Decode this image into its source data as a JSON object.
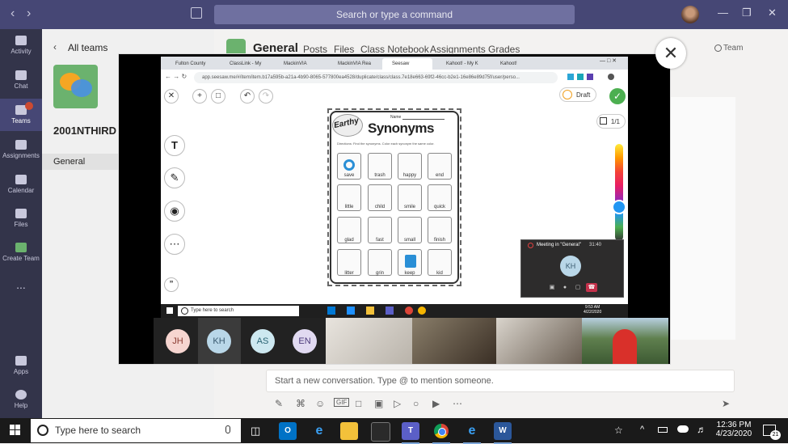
{
  "teams": {
    "search_placeholder": "Search or type a command",
    "rail": [
      {
        "label": "Activity"
      },
      {
        "label": "Chat"
      },
      {
        "label": "Teams"
      },
      {
        "label": "Assignments"
      },
      {
        "label": "Calendar"
      },
      {
        "label": "Files"
      },
      {
        "label": "Create Team"
      },
      {
        "label": "Apps"
      },
      {
        "label": "Help"
      }
    ],
    "teams_badge": "",
    "more_label": "...",
    "all_teams": "All teams",
    "team_name": "2001NTHIRD",
    "channel": "General",
    "header": {
      "title": "General",
      "tabs": [
        "Posts",
        "Files",
        "Class Notebook",
        "Assignments",
        "Grades"
      ],
      "team_button": "Team"
    },
    "compose_placeholder": "Start a new conversation. Type @ to mention someone."
  },
  "shared_screen": {
    "browser_tabs": [
      "Fulton County",
      "ClassLink - My",
      "MackinVIA",
      "MackinVIA Rea",
      "Seesaw",
      "Kahoot! - My K",
      "Kahoot!"
    ],
    "url": "app.seesaw.me/#/item/item.b17a595b-a21a-4b90-8065-577800ea4528/duplicate/class/class.7e18e663-69f2-46cc-b2e1-16e86e89d75f/user/perso...",
    "draft_label": "Draft",
    "page_count": "1/1",
    "worksheet": {
      "earthy": "Earthy",
      "title": "Synonyms",
      "name_label": "Name",
      "directions": "Directions: Find the synonyms. Color each synonym the same color.",
      "words": [
        [
          "save",
          "trash",
          "happy",
          "end"
        ],
        [
          "little",
          "child",
          "smile",
          "quick"
        ],
        [
          "glad",
          "fast",
          "small",
          "finish"
        ],
        [
          "litter",
          "grin",
          "keep",
          "kid"
        ]
      ]
    },
    "inner_search": "Type here to search",
    "inner_time": "9:53 AM",
    "inner_date": "4/22/2020",
    "mini_meeting": {
      "title": "Meeting in \"General\"",
      "time": "31:40",
      "avatar": "KH"
    }
  },
  "participants": [
    "JH",
    "KH",
    "AS",
    "EN"
  ],
  "taskbar": {
    "search": "Type here to search",
    "time": "12:36 PM",
    "date": "4/23/2020",
    "notifications": "21"
  }
}
